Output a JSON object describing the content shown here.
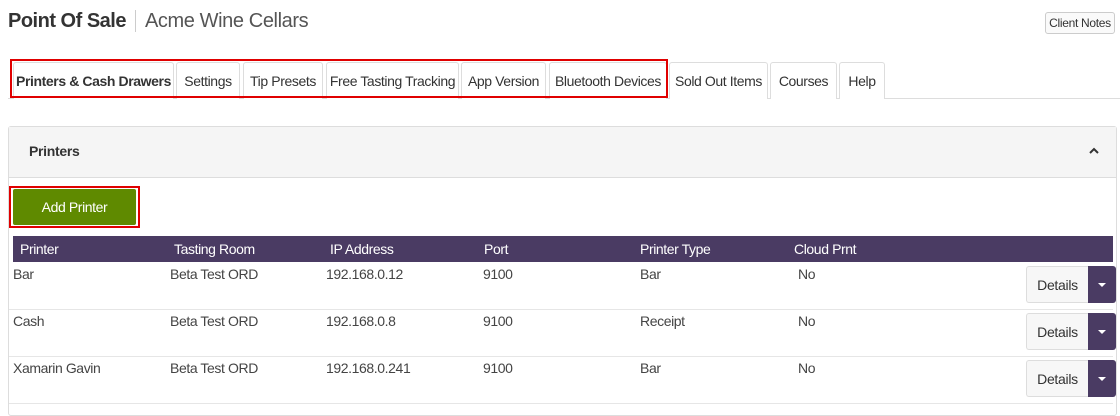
{
  "header": {
    "title": "Point Of Sale",
    "subtitle": "Acme Wine Cellars",
    "client_notes_label": "Client Notes"
  },
  "tabs": [
    {
      "label": "Printers & Cash Drawers",
      "active": true
    },
    {
      "label": "Settings",
      "active": false
    },
    {
      "label": "Tip Presets",
      "active": false
    },
    {
      "label": "Free Tasting Tracking",
      "active": false
    },
    {
      "label": "App Version",
      "active": false
    },
    {
      "label": "Bluetooth Devices",
      "active": false
    },
    {
      "label": "Sold Out Items",
      "active": false
    },
    {
      "label": "Courses",
      "active": false
    },
    {
      "label": "Help",
      "active": false
    }
  ],
  "panel": {
    "title": "Printers",
    "add_button_label": "Add Printer"
  },
  "table": {
    "columns": [
      "Printer",
      "Tasting Room",
      "IP Address",
      "Port",
      "Printer Type",
      "Cloud Prnt"
    ],
    "rows": [
      {
        "printer": "Bar",
        "room": "Beta Test ORD",
        "ip": "192.168.0.12",
        "port": "9100",
        "type": "Bar",
        "cloud": "No"
      },
      {
        "printer": "Cash",
        "room": "Beta Test ORD",
        "ip": "192.168.0.8",
        "port": "9100",
        "type": "Receipt",
        "cloud": "No"
      },
      {
        "printer": "Xamarin Gavin",
        "room": "Beta Test ORD",
        "ip": "192.168.0.241",
        "port": "9100",
        "type": "Bar",
        "cloud": "No"
      }
    ],
    "details_label": "Details"
  },
  "colors": {
    "accent_purple": "#4a3b63",
    "add_green": "#5f8a00",
    "highlight_red": "#e00000"
  }
}
